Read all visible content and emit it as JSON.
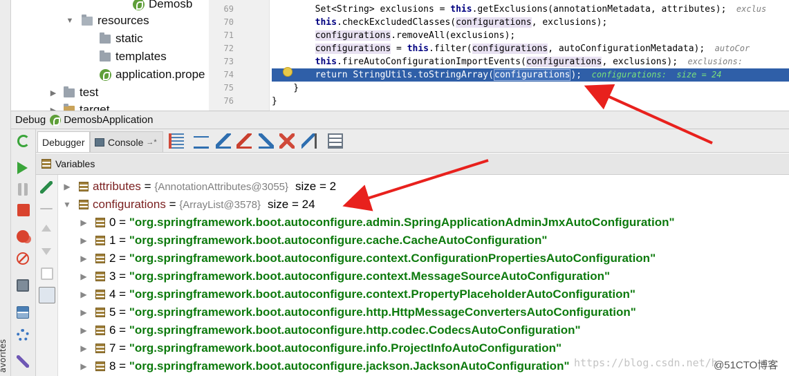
{
  "favorites_label": "avorites",
  "project_tree": {
    "items": [
      {
        "label": "Demosb",
        "indent": 3
      },
      {
        "label": "resources",
        "indent": 1
      },
      {
        "label": "static",
        "indent": 2
      },
      {
        "label": "templates",
        "indent": 2
      },
      {
        "label": "application.prope",
        "indent": 2
      },
      {
        "label": "test",
        "indent": 0
      },
      {
        "label": "target",
        "indent": 0
      }
    ]
  },
  "editor": {
    "line_numbers": [
      "69",
      "70",
      "71",
      "72",
      "73",
      "74",
      "75",
      "76"
    ],
    "lines": [
      {
        "pre": "        Set<String> exclusions = ",
        "kw": "this",
        "post": ".getExclusions(annotationMetadata, attributes);",
        "hint": "  exclus"
      },
      {
        "pre": "        ",
        "kw": "this",
        "post": ".checkExcludedClasses(",
        "hl": "configurations",
        "post2": ", exclusions);",
        "hint": ""
      },
      {
        "pre": "        ",
        "hl0": "configurations",
        "post": ".removeAll(exclusions);",
        "hint": ""
      },
      {
        "pre": "        ",
        "hl0": "configurations",
        "post": " = ",
        "kw": "this",
        "post2": ".filter(",
        "hl": "configurations",
        "post3": ", autoConfigurationMetadata);",
        "hint": "  autoCor"
      },
      {
        "pre": "        ",
        "kw": "this",
        "post": ".fireAutoConfigurationImportEvents(",
        "hl": "configurations",
        "post2": ", exclusions);",
        "hint": "  exclusions:"
      },
      {
        "pre": "        return StringUtils.toStringArray(",
        "hl": "configurations",
        "post": ");",
        "hint": "  configurations:  size = 24"
      },
      {
        "text": "    }"
      },
      {
        "text": "}"
      }
    ]
  },
  "debug_header": {
    "title": "Debug",
    "config": "DemosbApplication"
  },
  "tabs": {
    "debugger": "Debugger",
    "console": "Console",
    "console_suffix": "→*"
  },
  "variables": {
    "header": "Variables",
    "rows": [
      {
        "arrow": "▶",
        "name": "attributes",
        "eq": " = ",
        "ref": "{AnnotationAttributes@3055}",
        "size": "size = 2"
      },
      {
        "arrow": "▼",
        "name": "configurations",
        "eq": " = ",
        "ref": "{ArrayList@3578}",
        "size": "size = 24"
      }
    ],
    "elements": [
      {
        "idx": "0 = ",
        "val": "\"org.springframework.boot.autoconfigure.admin.SpringApplicationAdminJmxAutoConfiguration\""
      },
      {
        "idx": "1 = ",
        "val": "\"org.springframework.boot.autoconfigure.cache.CacheAutoConfiguration\""
      },
      {
        "idx": "2 = ",
        "val": "\"org.springframework.boot.autoconfigure.context.ConfigurationPropertiesAutoConfiguration\""
      },
      {
        "idx": "3 = ",
        "val": "\"org.springframework.boot.autoconfigure.context.MessageSourceAutoConfiguration\""
      },
      {
        "idx": "4 = ",
        "val": "\"org.springframework.boot.autoconfigure.context.PropertyPlaceholderAutoConfiguration\""
      },
      {
        "idx": "5 = ",
        "val": "\"org.springframework.boot.autoconfigure.http.HttpMessageConvertersAutoConfiguration\""
      },
      {
        "idx": "6 = ",
        "val": "\"org.springframework.boot.autoconfigure.http.codec.CodecsAutoConfiguration\""
      },
      {
        "idx": "7 = ",
        "val": "\"org.springframework.boot.autoconfigure.info.ProjectInfoAutoConfiguration\""
      },
      {
        "idx": "8 = ",
        "val": "\"org.springframework.boot.autoconfigure.jackson.JacksonAutoConfiguration\""
      }
    ]
  },
  "watermarks": {
    "url": "https://blog.csdn.net/h",
    "brand": "@51CTO博客"
  },
  "colors": {
    "highlight_line": "#2f5fa8",
    "value_green": "#0d7a0d",
    "name_red": "#7a1f1f",
    "arrow_red": "#e8211d"
  }
}
